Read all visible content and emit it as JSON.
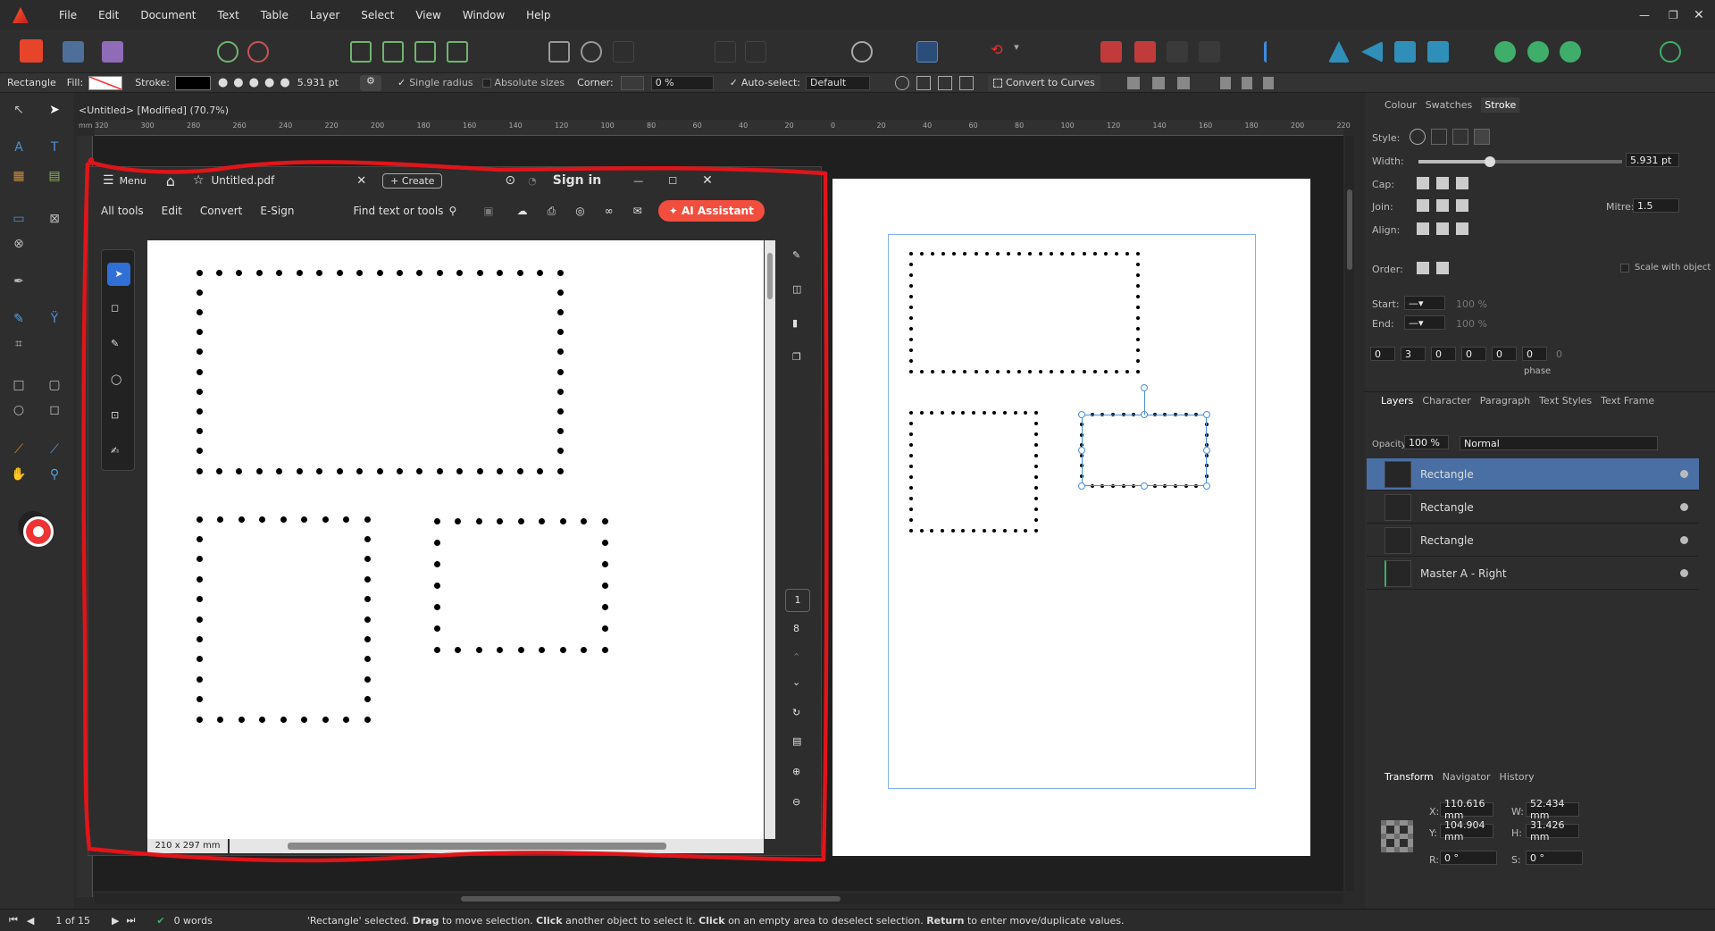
{
  "app": {
    "logo_icon": "affinity-publisher-logo-icon",
    "document_tab": "<Untitled> [Modified] (70.7%)"
  },
  "menu": [
    "File",
    "Edit",
    "Document",
    "Text",
    "Table",
    "Layer",
    "Select",
    "View",
    "Window",
    "Help"
  ],
  "context": {
    "tool": "Rectangle",
    "fill": "Fill:",
    "stroke": "Stroke:",
    "stroke_width": "5.931 pt",
    "single_radius": "Single radius",
    "absolute_sizes": "Absolute sizes",
    "corner": "Corner:",
    "corner_value": "0 %",
    "auto_select": "Auto-select:",
    "auto_select_value": "Default",
    "convert": "Convert to Curves"
  },
  "ruler_h": [
    "320",
    "300",
    "280",
    "260",
    "240",
    "220",
    "200",
    "180",
    "160",
    "140",
    "120",
    "100",
    "80",
    "60",
    "40",
    "20",
    "0",
    "20",
    "40",
    "60",
    "80",
    "100",
    "120",
    "140",
    "160",
    "180",
    "200",
    "220"
  ],
  "ruler_unit": "mm",
  "acrobat": {
    "menu": "Menu",
    "tab": "Untitled.pdf",
    "create": "Create",
    "sign_in": "Sign in",
    "tools": [
      "All tools",
      "Edit",
      "Convert",
      "E-Sign"
    ],
    "find": "Find text or tools",
    "ai": "AI Assistant",
    "page_size": "210 x 297 mm",
    "page_current": "1",
    "page_total": "8"
  },
  "right_panel": {
    "top_tabs": [
      "Colour",
      "Swatches",
      "Stroke"
    ],
    "style": "Style:",
    "width": "Width:",
    "width_value": "5.931 pt",
    "cap": "Cap:",
    "join": "Join:",
    "mitre": "Mitre:",
    "mitre_value": "1.5",
    "align": "Align:",
    "order": "Order:",
    "scale": "Scale with object",
    "start": "Start:",
    "end": "End:",
    "start_pct": "100 %",
    "end_pct": "100 %",
    "dash": [
      "0",
      "3",
      "0",
      "0",
      "0",
      "0"
    ],
    "dash_extra": "0",
    "phase": "phase",
    "layer_tabs": [
      "Layers",
      "Character",
      "Paragraph",
      "Text Styles",
      "Text Frame"
    ],
    "opacity": "Opacity:",
    "opacity_value": "100 %",
    "blend": "Normal",
    "layers": [
      "Rectangle",
      "Rectangle",
      "Rectangle",
      "Master A - Right"
    ],
    "transform_tabs": [
      "Transform",
      "Navigator",
      "History"
    ],
    "x": "110.616 mm",
    "y": "104.904 mm",
    "w": "52.434 mm",
    "h": "31.426 mm",
    "r": "0 °",
    "s": "0 °"
  },
  "status": {
    "pages": "1 of 15",
    "words": "0 words",
    "message_parts": [
      "'Rectangle' selected. ",
      "Drag",
      " to move selection. ",
      "Click",
      " another object to select it. ",
      "Click",
      " on an empty area to deselect selection. ",
      "Return",
      " to enter move/duplicate values."
    ]
  },
  "colors": {
    "accent": "#2f6fd6",
    "annotation": "#e0151a",
    "ai_button": "#f24e3e",
    "selected_layer": "#4a6fa5"
  }
}
